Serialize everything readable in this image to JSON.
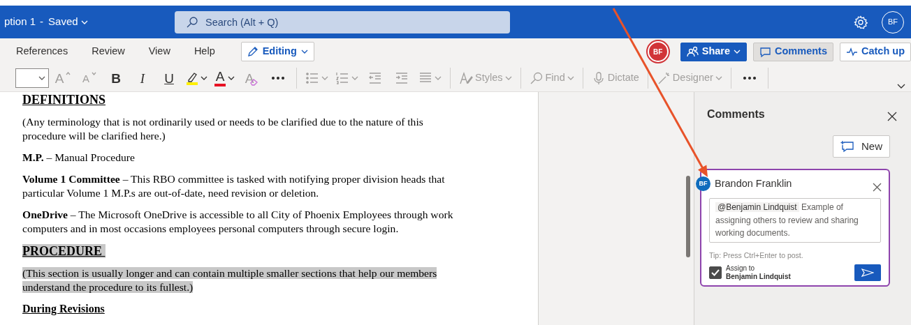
{
  "app_bar": {
    "title": "ption 1",
    "separator": "-",
    "status": "Saved",
    "search": {
      "placeholder": "Search (Alt + Q)"
    },
    "account": "BF"
  },
  "ribbon": {
    "tabs": [
      {
        "label": "References"
      },
      {
        "label": "Review"
      },
      {
        "label": "View"
      },
      {
        "label": "Help"
      }
    ],
    "mode": "Editing",
    "presence": "BF",
    "actions": [
      {
        "kind": "share",
        "label": "Share",
        "pressed": false
      },
      {
        "kind": "comments",
        "label": "Comments",
        "pressed": true
      },
      {
        "kind": "catchup",
        "label": "Catch up",
        "pressed": false
      }
    ]
  },
  "toolbar": {
    "groups": [
      [
        {
          "kind": "fontsize"
        },
        {
          "kind": "grow",
          "label": "A",
          "disabled": true
        },
        {
          "kind": "shrink",
          "label": "A",
          "disabled": true
        },
        {
          "kind": "bold",
          "label": "B",
          "disabled": false
        },
        {
          "kind": "italic",
          "label": "I",
          "disabled": false
        },
        {
          "kind": "underline",
          "label": "U",
          "disabled": false
        },
        {
          "kind": "highlight",
          "disabled": false
        },
        {
          "kind": "color",
          "label": "A",
          "disabled": false
        },
        {
          "kind": "clear",
          "label": "A",
          "disabled": true
        },
        {
          "kind": "more",
          "disabled": false
        }
      ],
      [
        {
          "kind": "bullets",
          "disabled": true
        },
        {
          "kind": "numbering",
          "disabled": true
        },
        {
          "kind": "outdent",
          "disabled": true
        },
        {
          "kind": "indent",
          "disabled": true
        },
        {
          "kind": "align",
          "disabled": true
        }
      ],
      [
        {
          "kind": "styles",
          "label": "Styles",
          "disabled": true
        }
      ],
      [
        {
          "kind": "find",
          "label": "Find",
          "disabled": true
        }
      ],
      [
        {
          "kind": "dictate",
          "label": "Dictate",
          "disabled": true
        }
      ],
      [
        {
          "kind": "designer",
          "label": "Designer",
          "disabled": true
        }
      ],
      [
        {
          "kind": "more",
          "disabled": false
        }
      ]
    ]
  },
  "document": {
    "blocks": [
      {
        "kind": "heading",
        "text": "DEFINITIONS",
        "highlighted": false
      },
      {
        "kind": "paragraph",
        "text": "(Any terminology that is not ordinarily used or needs to be clarified due to the nature of this procedure will be clarified here.)",
        "highlighted": false
      },
      {
        "kind": "paragraph",
        "text": "**M.P.** – Manual Procedure",
        "highlighted": false
      },
      {
        "kind": "paragraph",
        "text": "**Volume 1 Committee** – This RBO committee is tasked with notifying proper division heads that particular Volume 1 M.P.s are out-of-date, need revision or deletion.",
        "highlighted": false
      },
      {
        "kind": "paragraph",
        "text": "**OneDrive** – The Microsoft OneDrive is accessible to all City of Phoenix Employees through work computers and in most occasions employees personal computers through secure login.",
        "highlighted": false
      },
      {
        "kind": "heading",
        "text": "PROCEDURE",
        "highlighted": true
      },
      {
        "kind": "paragraph",
        "text": "(This section is usually longer and can contain multiple smaller sections that help our members understand the procedure to its fullest.)",
        "highlighted": true
      },
      {
        "kind": "subheading",
        "text": "During Revisions",
        "highlighted": false
      }
    ]
  },
  "comments_pane": {
    "title": "Comments",
    "new_button": "New",
    "draft": {
      "avatar": "BF",
      "author": "Brandon Franklin",
      "mention": "@Benjamin Lindquist",
      "text": "Example of assigning others to review and sharing working documents.",
      "tip": "Tip: Press Ctrl+Enter to post.",
      "assign": {
        "checked": true,
        "label": "Assign to",
        "person": "Benjamin Lindquist"
      }
    }
  }
}
